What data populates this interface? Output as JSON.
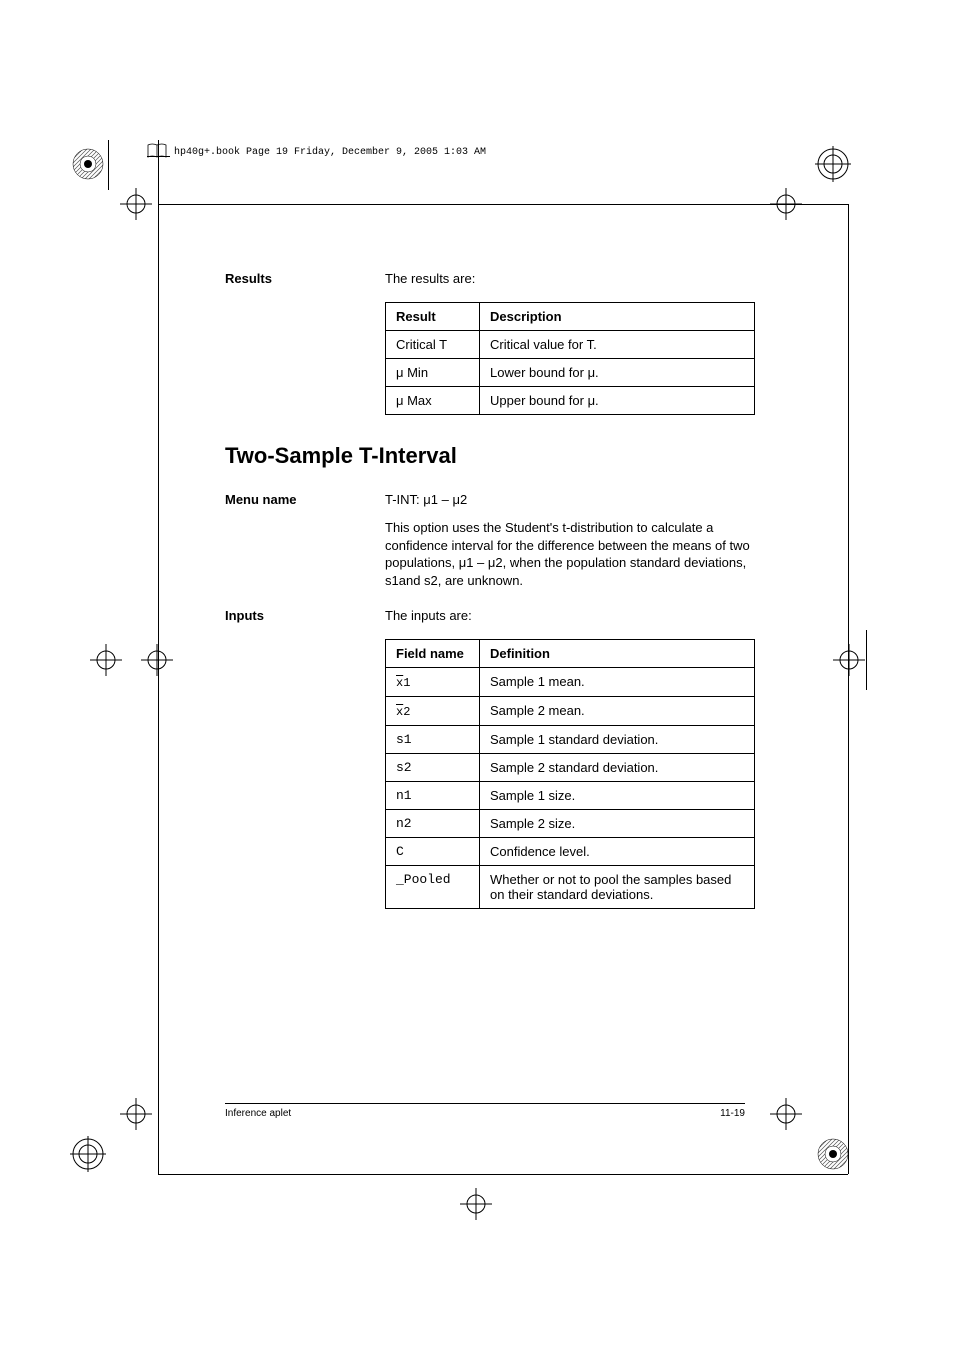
{
  "print_header": "hp40g+.book  Page 19  Friday, December 9, 2005  1:03 AM",
  "results": {
    "label": "Results",
    "intro": "The results are:",
    "table": {
      "headers": [
        "Result",
        "Description"
      ],
      "rows": [
        {
          "c0": "Critical T",
          "c1": "Critical value for T."
        },
        {
          "c0": "μ Min",
          "c1": "Lower bound for μ."
        },
        {
          "c0": "μ Max",
          "c1": "Upper bound for μ."
        }
      ]
    }
  },
  "section_heading": "Two-Sample T-Interval",
  "menu": {
    "label": "Menu name",
    "value": "T-INT: μ1 – μ2",
    "desc": "This option uses the Student's t-distribution to calculate a confidence interval for the difference between the means of two populations, μ1 – μ2, when the population standard deviations, s1and s2, are unknown."
  },
  "inputs": {
    "label": "Inputs",
    "intro": "The inputs are:",
    "table": {
      "headers": [
        "Field name",
        "Definition"
      ],
      "rows": [
        {
          "c0_xbar": "x",
          "c0_suffix": "1",
          "c1": "Sample 1 mean."
        },
        {
          "c0_xbar": "x",
          "c0_suffix": "2",
          "c1": "Sample 2 mean."
        },
        {
          "c0": "s1",
          "c1": "Sample 1 standard deviation."
        },
        {
          "c0": "s2",
          "c1": "Sample 2 standard deviation."
        },
        {
          "c0": "n1",
          "c1": "Sample 1 size."
        },
        {
          "c0": "n2",
          "c1": "Sample 2 size."
        },
        {
          "c0": "C",
          "c1": "Confidence level."
        },
        {
          "c0": "_Pooled",
          "c1": "Whether or not to pool the samples based on their standard deviations."
        }
      ]
    }
  },
  "footer": {
    "left": "Inference aplet",
    "right": "11-19"
  }
}
